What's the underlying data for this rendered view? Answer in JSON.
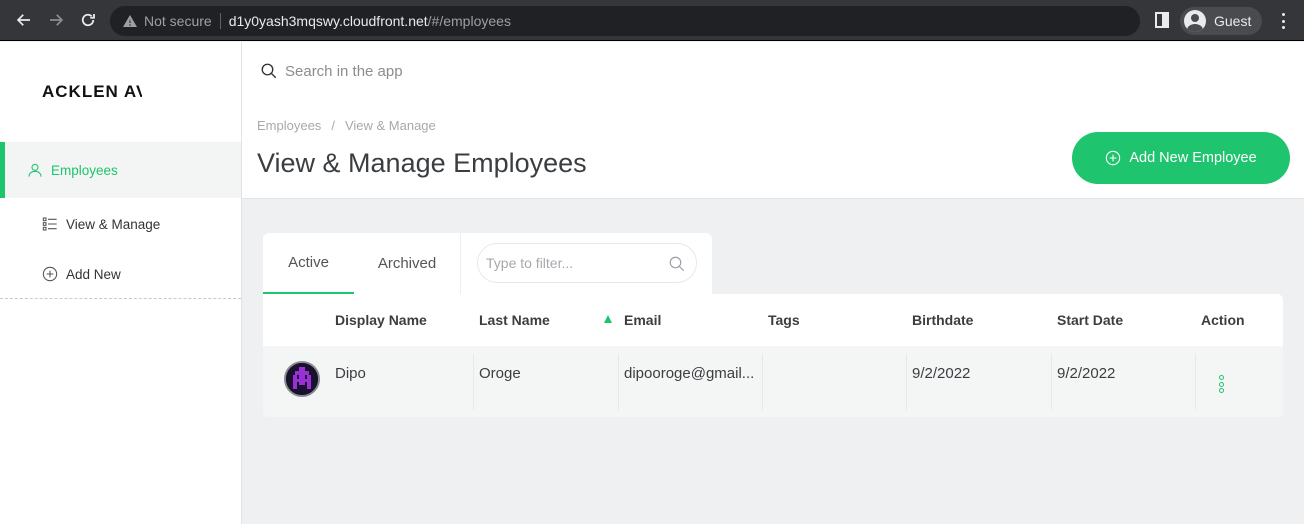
{
  "browser": {
    "security_label": "Not secure",
    "url_host": "d1y0yash3mqswy.cloudfront.net",
    "url_path": "/#/employees",
    "profile_label": "Guest"
  },
  "app": {
    "logo_text": "ACKLEN AVENUE",
    "search_placeholder": "Search in the app"
  },
  "sidebar": {
    "section_label": "Employees",
    "items": [
      {
        "label": "View & Manage",
        "icon": "list-icon"
      },
      {
        "label": "Add New",
        "icon": "plus-circle-icon"
      }
    ]
  },
  "header": {
    "breadcrumb": [
      "Employees",
      "View & Manage"
    ],
    "breadcrumb_sep": "/",
    "title": "View & Manage Employees",
    "add_button_label": "Add New Employee"
  },
  "tabs": {
    "items": [
      {
        "label": "Active",
        "active": true
      },
      {
        "label": "Archived",
        "active": false
      }
    ],
    "filter_placeholder": "Type to filter..."
  },
  "table": {
    "columns": [
      "Display Name",
      "Last Name",
      "Email",
      "Tags",
      "Birthdate",
      "Start Date",
      "Action"
    ],
    "sorted_column": "Email",
    "rows": [
      {
        "display_name": "Dipo",
        "last_name": "Oroge",
        "email": "dipooroge@gmail...",
        "tags": "",
        "birthdate": "9/2/2022",
        "start_date": "9/2/2022"
      }
    ]
  },
  "colors": {
    "accent": "#1fc46e",
    "browser_bg": "#35363a",
    "content_bg": "#eef0f1"
  }
}
